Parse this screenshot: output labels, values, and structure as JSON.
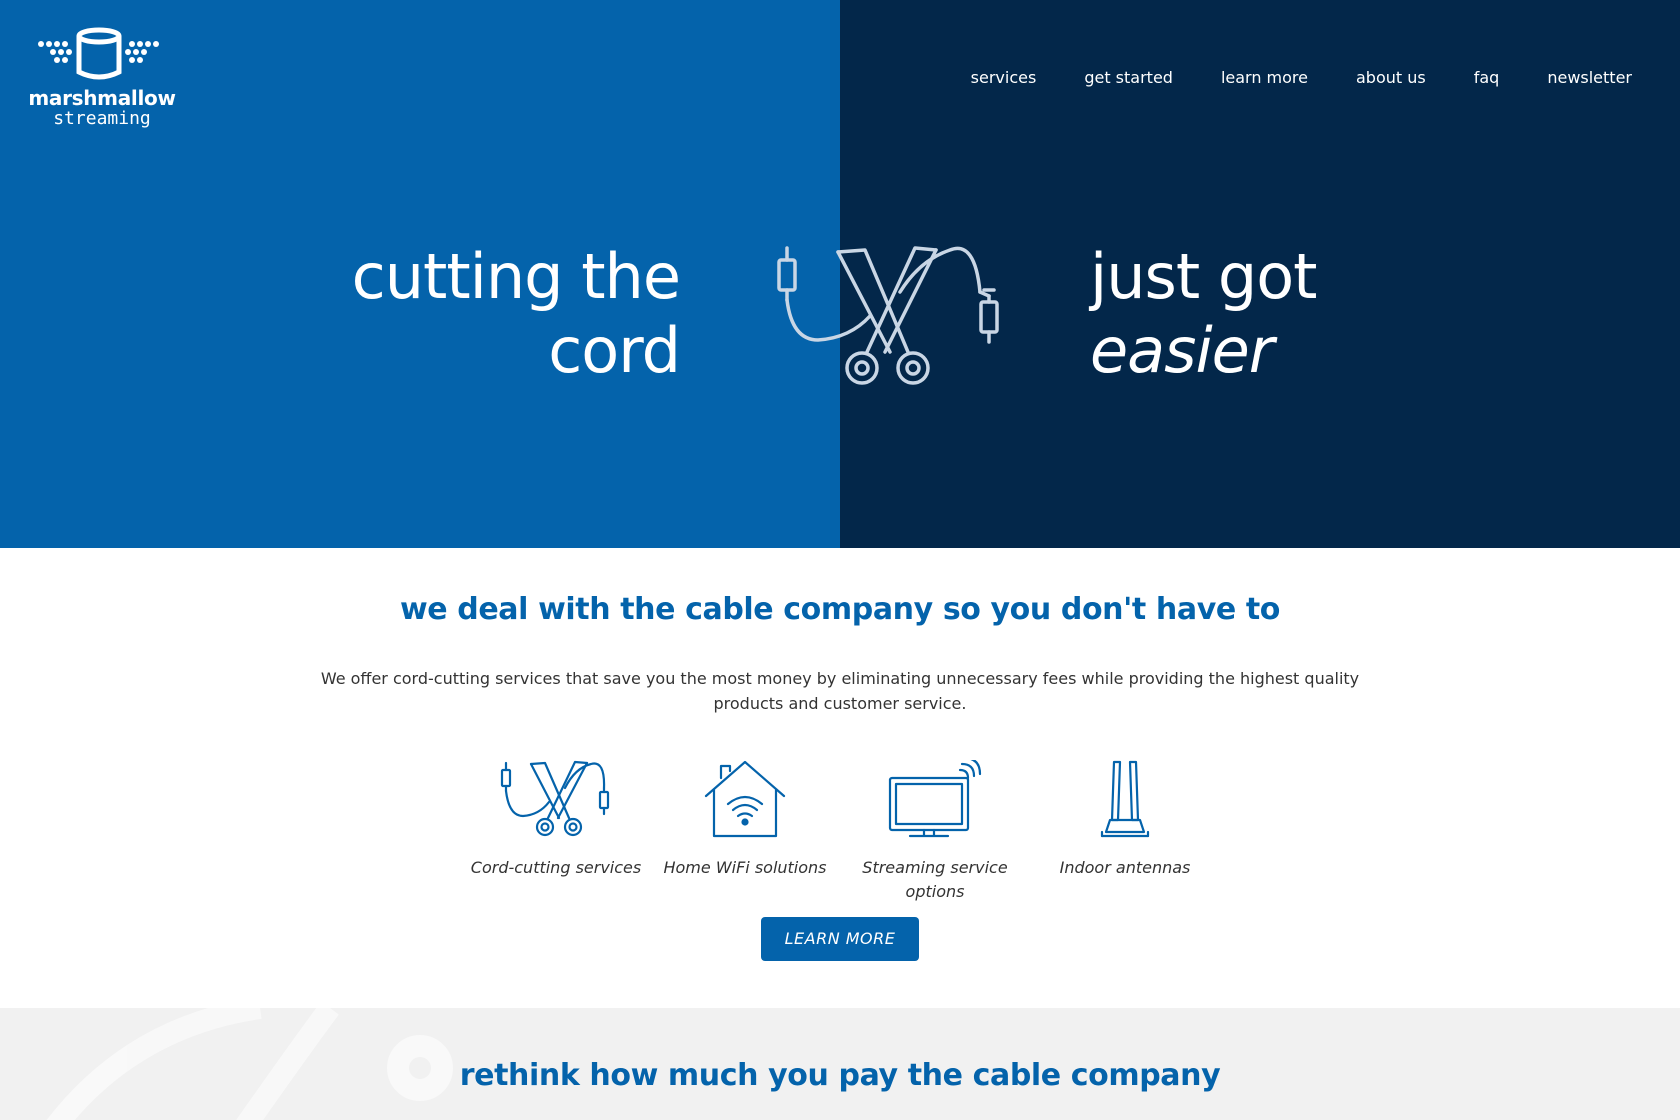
{
  "brand": {
    "name": "marshmallow",
    "tagline": "streaming"
  },
  "nav": {
    "items": [
      "services",
      "get started",
      "learn more",
      "about us",
      "faq",
      "newsletter"
    ]
  },
  "hero": {
    "left_line1": "cutting the",
    "left_line2": "cord",
    "right_line1": "just got",
    "right_line2": "easier"
  },
  "services": {
    "title": "we deal with the cable company so you don't have to",
    "description": "We offer cord-cutting services that save you the most money by eliminating unnecessary fees while providing the highest quality products and customer service.",
    "features": [
      {
        "label": "Cord-cutting services",
        "icon": "scissors-cable-icon"
      },
      {
        "label": "Home WiFi solutions",
        "icon": "house-wifi-icon"
      },
      {
        "label": "Streaming service options",
        "icon": "tv-signal-icon"
      },
      {
        "label": "Indoor antennas",
        "icon": "antenna-icon"
      }
    ],
    "cta_label": "LEARN MORE"
  },
  "rethink": {
    "title": "rethink how much you pay the cable company"
  },
  "colors": {
    "primary_blue": "#0463ab",
    "navy": "#03274a",
    "light_gray": "#f1f1f1",
    "text": "#333333"
  }
}
